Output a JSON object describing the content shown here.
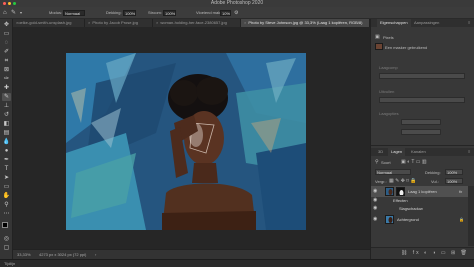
{
  "window": {
    "title": "Adobe Photoshop 2020"
  },
  "options_bar": {
    "mode_label": "Modus:",
    "mode_value": "Normaal",
    "opacity_label": "Dekking:",
    "opacity_value": "100%",
    "flow_label": "Stroom:",
    "flow_value": "100%",
    "smoothing_label": "Vloeiend maken:",
    "smoothing_value": "10%"
  },
  "tabs": [
    {
      "label": "×oelke-gold-smith-unsplash.jpg",
      "active": false
    },
    {
      "label": "Photo by Jacob Prose.jpg",
      "active": false
    },
    {
      "label": "woman-holding-her-face-2380657.jpg",
      "active": false
    },
    {
      "label": "Photo by Steve Johnson.jpg @ 33,3% (Laag 1 kopiëren, RGB/8)",
      "active": true
    }
  ],
  "status_bar": {
    "zoom": "33,33%",
    "doc_size": "4273 px x 3024 px (72 ppi)"
  },
  "bottom_bar": {
    "label": "Tijdlijn"
  },
  "properties_panel": {
    "tabs": [
      "Eigenschappen",
      "Aanpassingen"
    ],
    "mask_row_label": "Pixels",
    "layer_label": "Een masker gebruikend",
    "section_label_1": "Laagcomp",
    "section_label_2": "Uitvullen",
    "section_label_3": "Laagopties"
  },
  "layers_panel": {
    "tabs": [
      "3D",
      "Lagen",
      "Kanalen"
    ],
    "kind_label": "Soort",
    "blend_mode": "Normaal",
    "opacity_label": "Dekking:",
    "opacity_value": "100%",
    "lock_label": "Vergr.:",
    "fill_label": "Vul.:",
    "fill_value": "100%",
    "layers": [
      {
        "name": "Laag 1 kopiëren",
        "selected": true
      },
      {
        "name": "Effecten",
        "selected": false
      },
      {
        "name": "Slagschaduw",
        "selected": false
      },
      {
        "name": "Achtergrond",
        "selected": false
      }
    ]
  },
  "colors": {
    "accent_selected": "#505050",
    "foreground_swatch": "#000000",
    "background_swatch": "#ffffff",
    "painting_blue": "#2b6b9c",
    "painting_teal": "#3f8f9e"
  },
  "icons": [
    "traffic-close-icon",
    "traffic-minimize-icon",
    "traffic-zoom-icon",
    "brush-tool-icon",
    "eye-icon",
    "fx-icon",
    "lock-icon",
    "search-icon"
  ]
}
